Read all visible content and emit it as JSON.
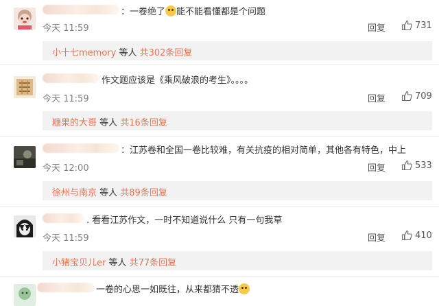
{
  "comments": [
    {
      "text_before": "：一卷绝了",
      "text_after": "能不能看懂都是个问题",
      "time": "今天 11:59",
      "reply_label": "回复",
      "likes": "731",
      "sub_user": "小十七memory",
      "sub_mid": " 等人 ",
      "sub_count": "共302条回复"
    },
    {
      "text": "作文题应该是《乘风破浪的考生》。。。。",
      "time": "今天 11:59",
      "reply_label": "回复",
      "likes": "709",
      "sub_user": "糖果的大哥",
      "sub_mid": " 等人 ",
      "sub_count": "共16条回复"
    },
    {
      "text": "：江苏卷和全国一卷比较难，有关抗疫的相对简单，其他各有特色，中上",
      "time": "今天 12:00",
      "reply_label": "回复",
      "likes": "533",
      "sub_user": "徐州与南京",
      "sub_mid": " 等人 ",
      "sub_count": "共89条回复"
    },
    {
      "text": ". 看看江苏作文，一时不知道说什么 只有一句我草",
      "time": "今天 11:59",
      "reply_label": "回复",
      "likes": "410",
      "sub_user": "小猪宝贝儿er",
      "sub_mid": " 等人 ",
      "sub_count": "共77条回复"
    },
    {
      "text": "一卷的心思一如既往，从来都猜不透"
    }
  ]
}
